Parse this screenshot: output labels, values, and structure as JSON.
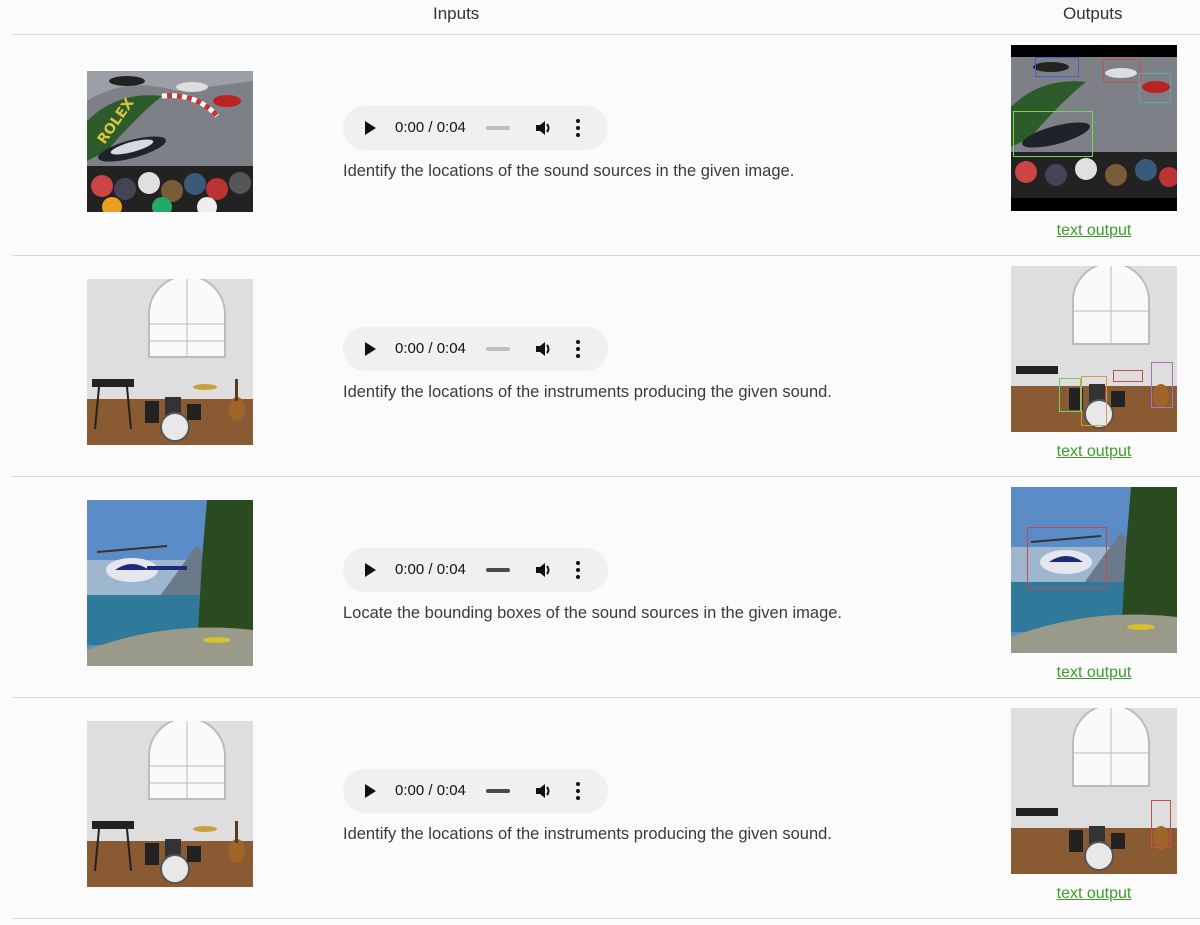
{
  "header": {
    "inputs_label": "Inputs",
    "outputs_label": "Outputs"
  },
  "rows": [
    {
      "audio": {
        "time": "0:00 / 0:04",
        "progress": 0
      },
      "prompt": "Identify the locations of the sound sources in the given image.",
      "output_link": "text output",
      "scene": "f1-race"
    },
    {
      "audio": {
        "time": "0:00 / 0:04",
        "progress": 0
      },
      "prompt": "Identify the locations of the instruments producing the given sound.",
      "output_link": "text output",
      "scene": "music-room"
    },
    {
      "audio": {
        "time": "0:00 / 0:04",
        "progress": 0
      },
      "prompt": "Locate the bounding boxes of the sound sources in the given image.",
      "output_link": "text output",
      "scene": "helicopter"
    },
    {
      "audio": {
        "time": "0:00 / 0:04",
        "progress": 0
      },
      "prompt": "Identify the locations of the instruments producing the given sound.",
      "output_link": "text output",
      "scene": "music-room"
    }
  ],
  "icons": [
    "play-icon",
    "volume-icon",
    "more-options-icon"
  ]
}
